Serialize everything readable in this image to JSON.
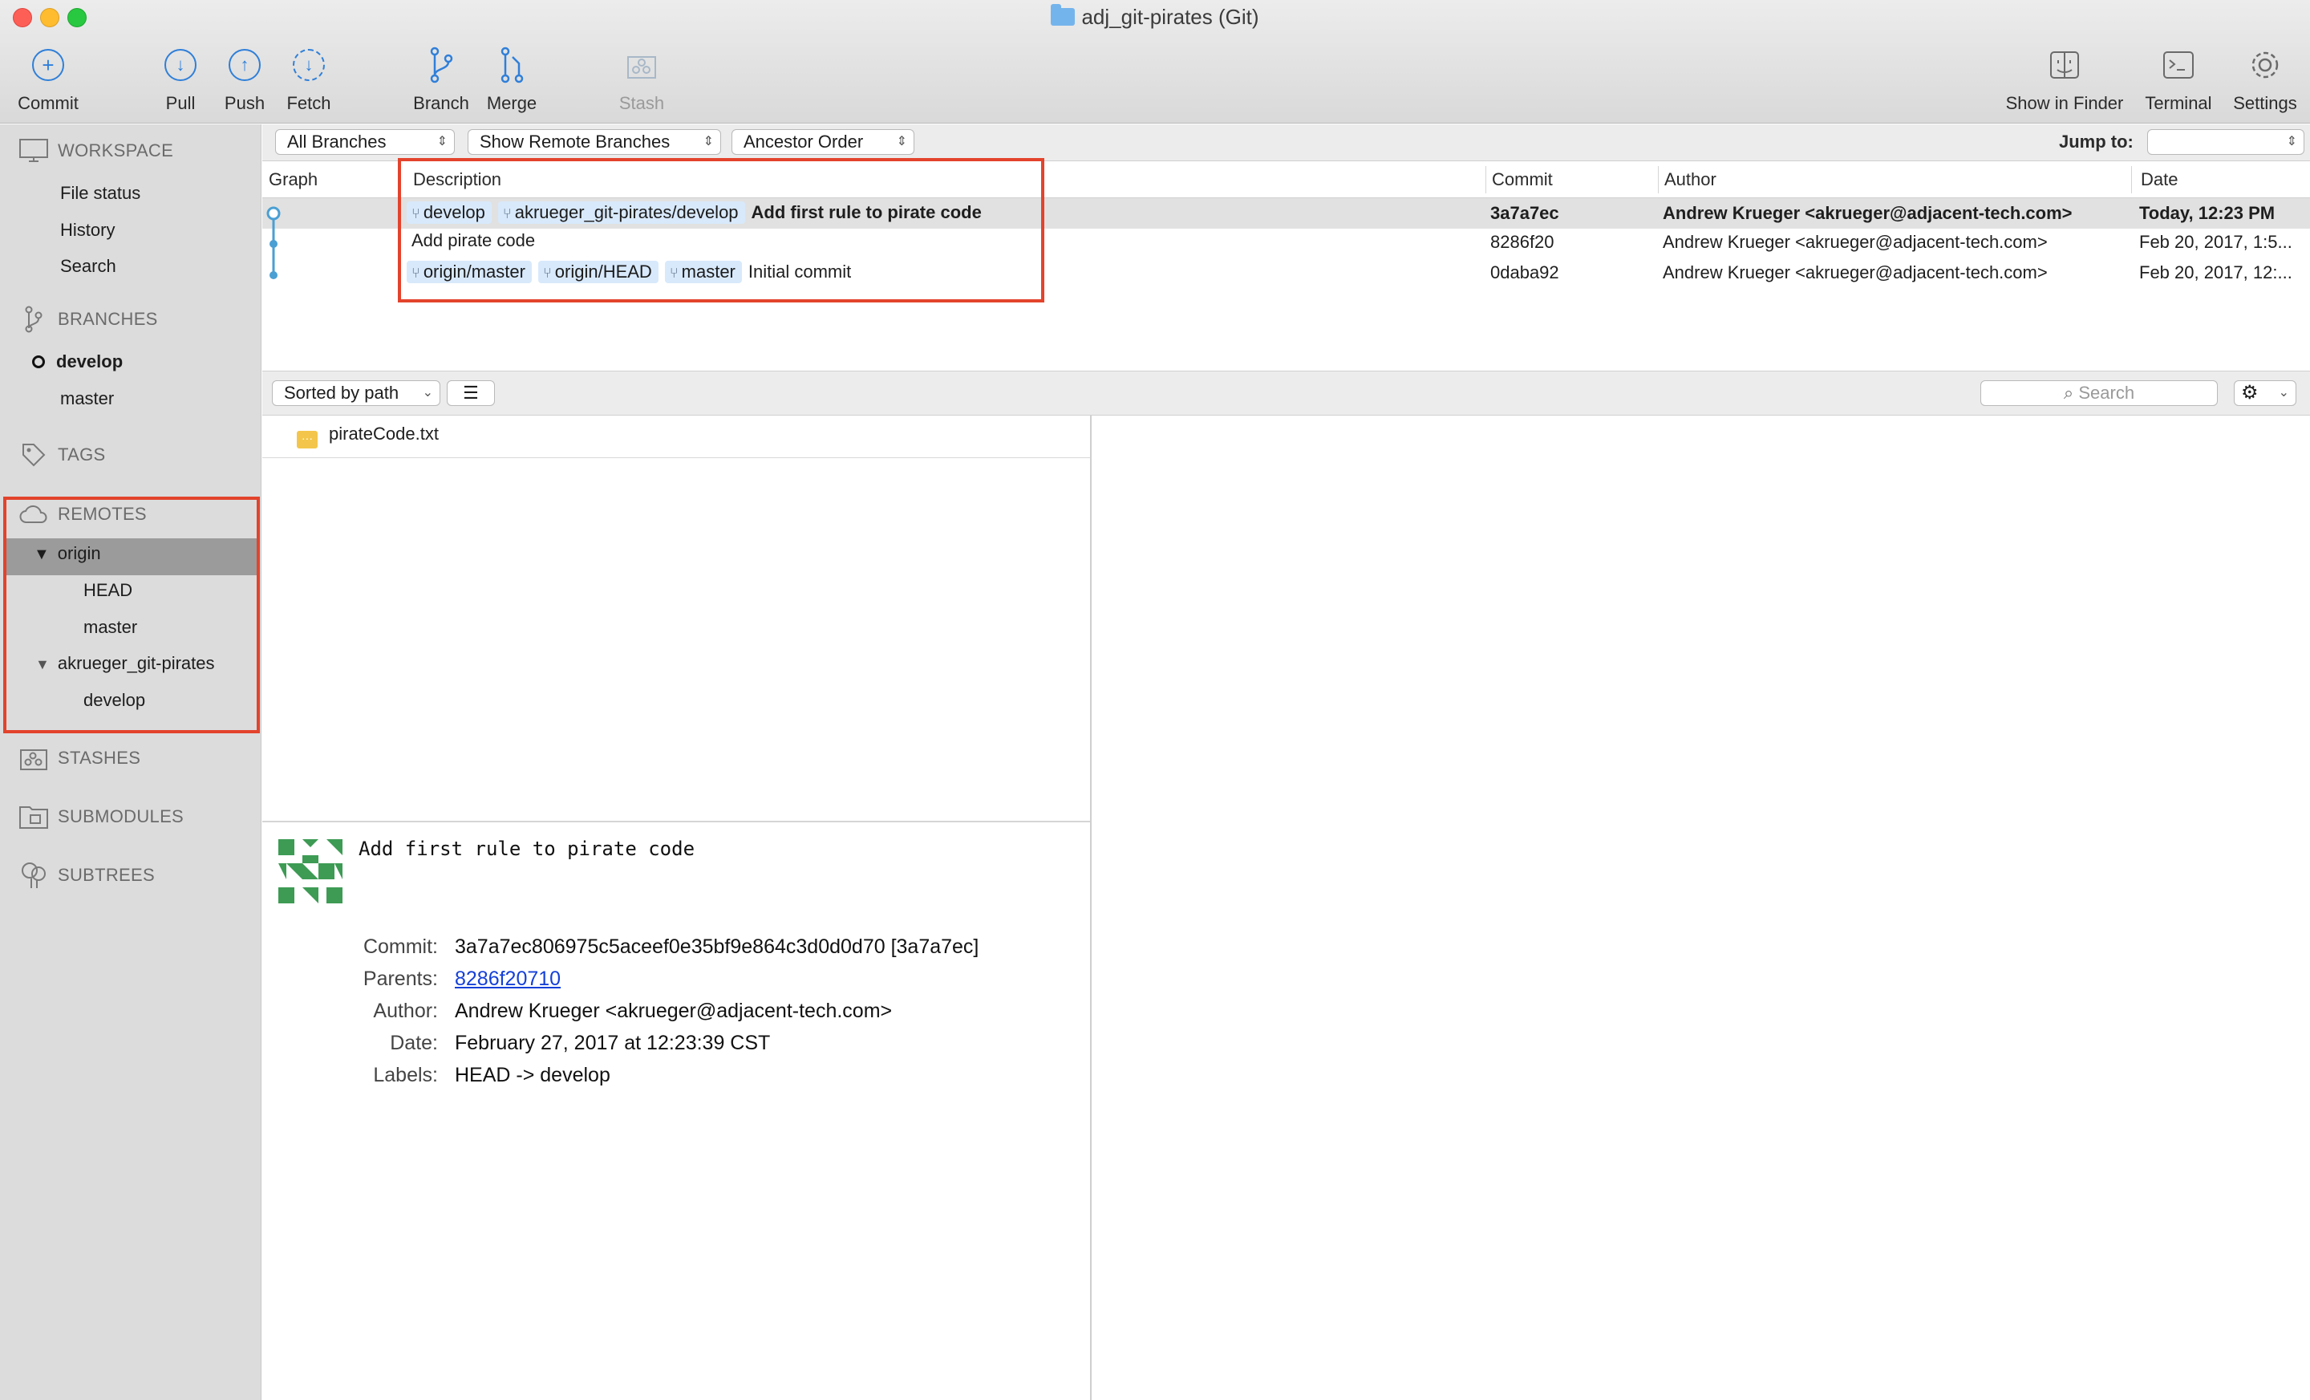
{
  "window": {
    "title": "adj_git-pirates (Git)"
  },
  "toolbar": {
    "commit": "Commit",
    "pull": "Pull",
    "push": "Push",
    "fetch": "Fetch",
    "branch": "Branch",
    "merge": "Merge",
    "stash": "Stash",
    "show_in_finder": "Show in Finder",
    "terminal": "Terminal",
    "settings": "Settings"
  },
  "sidebar": {
    "workspace": {
      "title": "WORKSPACE",
      "items": [
        "File status",
        "History",
        "Search"
      ]
    },
    "branches": {
      "title": "BRANCHES",
      "current": "develop",
      "other": "master"
    },
    "tags": {
      "title": "TAGS"
    },
    "remotes": {
      "title": "REMOTES",
      "origin": {
        "name": "origin",
        "children": [
          "HEAD",
          "master"
        ]
      },
      "fork": {
        "name": "akrueger_git-pirates",
        "children": [
          "develop"
        ]
      }
    },
    "stashes": {
      "title": "STASHES"
    },
    "submodules": {
      "title": "SUBMODULES"
    },
    "subtrees": {
      "title": "SUBTREES"
    }
  },
  "filters": {
    "branches": "All Branches",
    "remote": "Show Remote Branches",
    "order": "Ancestor Order",
    "jump_label": "Jump to:"
  },
  "table": {
    "headers": {
      "graph": "Graph",
      "description": "Description",
      "commit": "Commit",
      "author": "Author",
      "date": "Date"
    },
    "rows": [
      {
        "tags": [
          "develop",
          "akrueger_git-pirates/develop"
        ],
        "message": "Add first rule to pirate code",
        "commit": "3a7a7ec",
        "author": "Andrew Krueger <akrueger@adjacent-tech.com>",
        "date": "Today, 12:23 PM"
      },
      {
        "tags": [],
        "message": "Add pirate code",
        "commit": "8286f20",
        "author": "Andrew Krueger <akrueger@adjacent-tech.com>",
        "date": "Feb 20, 2017, 1:5..."
      },
      {
        "tags": [
          "origin/master",
          "origin/HEAD",
          "master"
        ],
        "message": "Initial commit",
        "commit": "0daba92",
        "author": "Andrew Krueger <akrueger@adjacent-tech.com>",
        "date": "Feb 20, 2017, 12:..."
      }
    ]
  },
  "files": {
    "sort": "Sorted by path",
    "search_placeholder": "Search",
    "items": [
      "pirateCode.txt"
    ]
  },
  "details": {
    "message": "Add first rule to pirate code",
    "commit_label": "Commit:",
    "commit": "3a7a7ec806975c5aceef0e35bf9e864c3d0d0d70 [3a7a7ec]",
    "parents_label": "Parents:",
    "parents": "8286f20710",
    "author_label": "Author:",
    "author": "Andrew Krueger <akrueger@adjacent-tech.com>",
    "date_label": "Date:",
    "date": "February 27, 2017 at 12:23:39 CST",
    "labels_label": "Labels:",
    "labels": "HEAD -> develop"
  },
  "colors": {
    "accent": "#2f7fd9",
    "highlight": "#e3432c",
    "tag_bg": "#d8e9fb",
    "graph": "#4a9fd3"
  }
}
